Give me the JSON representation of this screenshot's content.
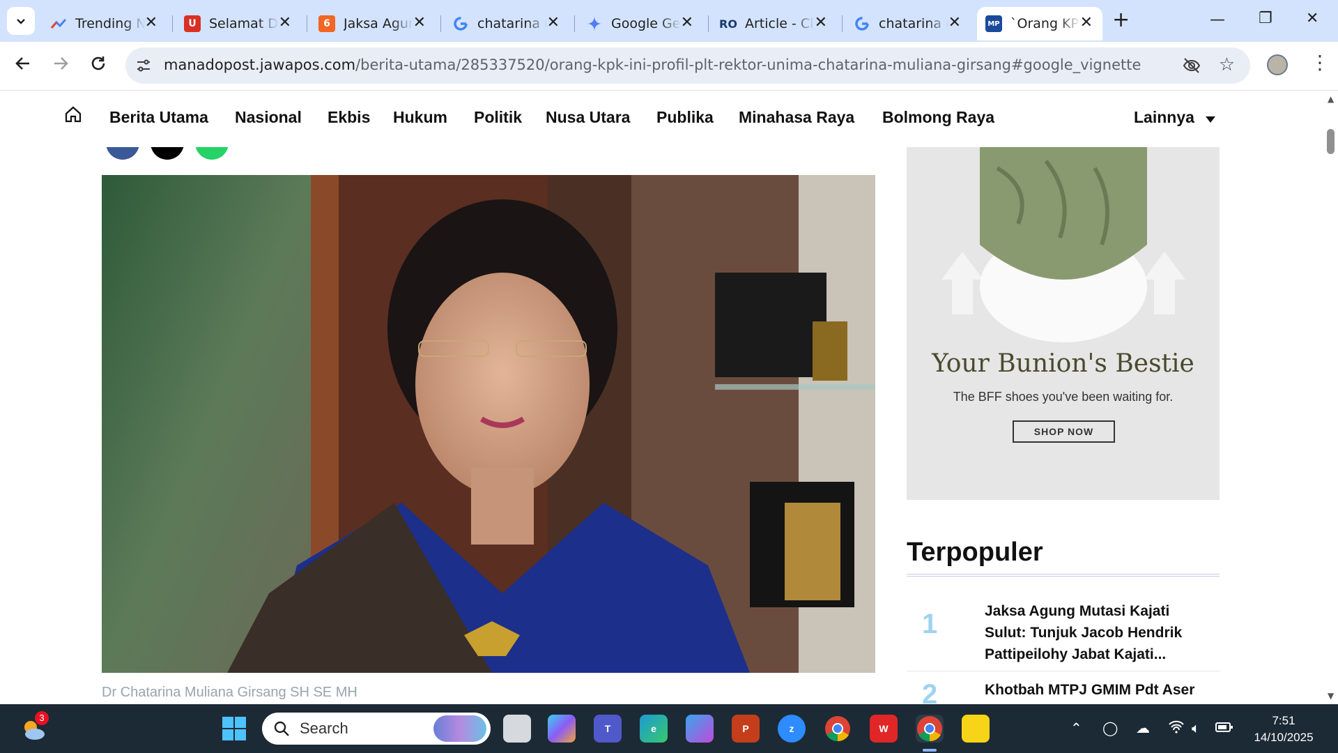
{
  "tabs": [
    {
      "title": "Trending N",
      "icon": "trending-icon",
      "color": "#4285f4"
    },
    {
      "title": "Selamat Da",
      "icon": "selamat-site-icon",
      "color": "#d93025"
    },
    {
      "title": "Jaksa Agun",
      "icon": "liputan6-icon",
      "color": "#f26522"
    },
    {
      "title": "chatarina g",
      "icon": "google-icon",
      "color": "#4285f4"
    },
    {
      "title": "Google Ge",
      "icon": "gemini-icon",
      "color": "#4f7cf7"
    },
    {
      "title": "Article - Cl",
      "icon": "article-site-icon",
      "color": "#1a3a6e"
    },
    {
      "title": "chatarina g",
      "icon": "google-icon",
      "color": "#4285f4"
    },
    {
      "title": "`Orang KP",
      "icon": "manadopost-icon",
      "color": "#1a4a9c"
    }
  ],
  "address": {
    "domain": "manadopost.jawapos.com",
    "path": "/berita-utama/285337520/orang-kpk-ini-profil-plt-rektor-unima-chatarina-muliana-girsang#google_vignette"
  },
  "site_nav": [
    "Berita Utama",
    "Nasional",
    "Ekbis",
    "Hukum",
    "Politik",
    "Nusa Utara",
    "Publika",
    "Minahasa Raya",
    "Bolmong Raya"
  ],
  "site_nav_more": "Lainnya",
  "article": {
    "caption": "Dr Chatarina Muliana Girsang SH SE MH"
  },
  "ad": {
    "headline": "Your Bunion's Bestie",
    "sub": "The BFF shoes you've been waiting for.",
    "cta": "SHOP NOW"
  },
  "popular": {
    "heading": "Terpopuler",
    "items": [
      {
        "rank": "1",
        "title": "Jaksa Agung Mutasi Kajati Sulut: Tunjuk Jacob Hendrik Pattipeilohy Jabat Kajati..."
      },
      {
        "rank": "2",
        "title": "Khotbah MTPJ GMIM Pdt Aser"
      }
    ]
  },
  "taskbar": {
    "search_label": "Search",
    "weather_badge": "3",
    "time": "7:51",
    "date": "14/10/2025"
  }
}
